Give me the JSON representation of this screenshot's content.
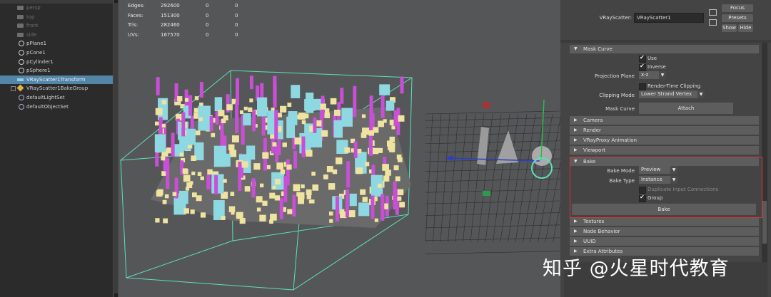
{
  "outliner": {
    "items": [
      {
        "label": "persp",
        "kind": "cam"
      },
      {
        "label": "top",
        "kind": "cam"
      },
      {
        "label": "front",
        "kind": "cam"
      },
      {
        "label": "side",
        "kind": "cam"
      },
      {
        "label": "pPlane1",
        "kind": "mesh"
      },
      {
        "label": "pCone1",
        "kind": "mesh"
      },
      {
        "label": "pCylinder1",
        "kind": "mesh"
      },
      {
        "label": "pSphere1",
        "kind": "mesh"
      },
      {
        "label": "VRayScatter1Transform",
        "kind": "sel"
      },
      {
        "label": "VRayScatter1BakeGroup",
        "kind": "grp"
      },
      {
        "label": "defaultLightSet",
        "kind": "set"
      },
      {
        "label": "defaultObjectSet",
        "kind": "set"
      }
    ]
  },
  "hud": {
    "rows": [
      {
        "label": "Edges:",
        "v1": "292600",
        "v2": "0",
        "v3": "0"
      },
      {
        "label": "Faces:",
        "v1": "151300",
        "v2": "0",
        "v3": "0"
      },
      {
        "label": "Tris:",
        "v1": "282460",
        "v2": "0",
        "v3": "0"
      },
      {
        "label": "UVs:",
        "v1": "167570",
        "v2": "0",
        "v3": "0"
      }
    ]
  },
  "attr": {
    "node_label": "VRayScatter:",
    "node_name": "VRayScatter1",
    "buttons": {
      "focus": "Focus",
      "presets": "Presets",
      "show": "Show",
      "hide": "Hide"
    },
    "mask_curve": {
      "title": "Mask Curve",
      "use_label": "Use",
      "use_checked": true,
      "inverse_label": "Inverse",
      "inverse_checked": true,
      "projection_label": "Projection Plane",
      "projection_value": "x-z",
      "render_time_clipping_label": "Render-Time Clipping",
      "render_time_clipping_checked": false,
      "clipping_mode_label": "Clipping Mode",
      "clipping_mode_value": "Lower Strand Vertex",
      "mask_curve_label": "Mask Curve",
      "attach_label": "Attach"
    },
    "collapsed_sections_1": [
      "Camera",
      "Render",
      "VRayProxy Animation",
      "Viewport"
    ],
    "bake": {
      "title": "Bake",
      "mode_label": "Bake Mode",
      "mode_value": "Preview",
      "type_label": "Bake Type",
      "type_value": "Instance",
      "duplicate_label": "Duplicate Input Connections",
      "duplicate_checked": false,
      "group_label": "Group",
      "group_checked": true,
      "bake_button": "Bake"
    },
    "collapsed_sections_2": [
      "Textures",
      "Node Behavior",
      "UUID",
      "Extra Attributes"
    ]
  },
  "watermark": "知乎 @火星时代教育",
  "colors": {
    "selection": "#5285a6",
    "highlight_box": "#d43a3a",
    "bbox": "#5de0b8"
  }
}
